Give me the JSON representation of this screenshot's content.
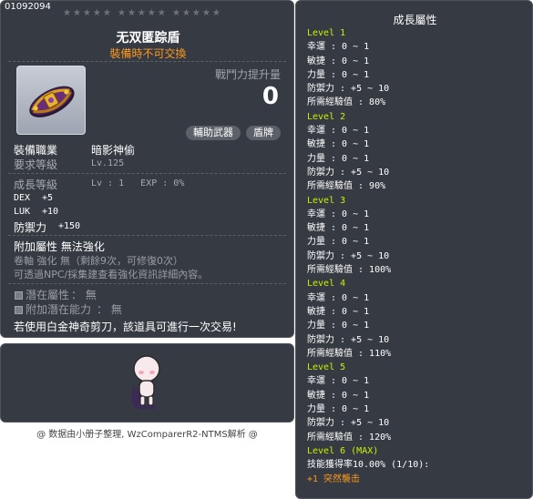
{
  "item": {
    "id": "01092094",
    "stars": "★★★★★ ★★★★★ ★★★★★",
    "name": "无双匿踪盾",
    "trade_note": "裝備時不可交換",
    "power_label": "戰鬥力提升量",
    "power_value": "0",
    "tags": [
      "輔助武器",
      "盾牌"
    ],
    "job_label": "裝備職業",
    "job_value": "暗影神偷",
    "req_label": "要求等級",
    "req_value": "Lv.125",
    "growth_label": "成長等級",
    "growth_value": "Lv : 1   EXP : 0%",
    "stats": [
      {
        "name": "DEX",
        "value": "+5"
      },
      {
        "name": "LUK",
        "value": "+10"
      },
      {
        "name": "防禦力",
        "value": "+150"
      }
    ],
    "enhance_line": "附加屬性 無法強化",
    "scroll_line": "卷軸 強化 無（剩餘9次，可修復0次）",
    "npc_line": "可透過NPC/採集建查看強化資訊詳細內容。",
    "potential_label": "潛在屬性",
    "potential_value": "： 無",
    "bonus_potential_label": "附加潛在能力",
    "bonus_potential_value": "： 無",
    "scissors_note": "若使用白金神奇剪刀，該道具可進行一次交易!"
  },
  "footer": {
    "credit": "@ 数据由小册子整理, WzComparerR2-NTMS解析 @"
  },
  "growth": {
    "title": "成長屬性",
    "lines": [
      {
        "text": "Level 1",
        "type": "level"
      },
      {
        "text": "幸運 : 0 ~ 1",
        "type": "stat"
      },
      {
        "text": "敏捷 : 0 ~ 1",
        "type": "stat"
      },
      {
        "text": "力量 : 0 ~ 1",
        "type": "stat"
      },
      {
        "text": "防禦力 : +5 ~ 10",
        "type": "stat"
      },
      {
        "text": "所需經驗值 : 80%",
        "type": "stat"
      },
      {
        "text": "Level 2",
        "type": "level"
      },
      {
        "text": "幸運 : 0 ~ 1",
        "type": "stat"
      },
      {
        "text": "敏捷 : 0 ~ 1",
        "type": "stat"
      },
      {
        "text": "力量 : 0 ~ 1",
        "type": "stat"
      },
      {
        "text": "防禦力 : +5 ~ 10",
        "type": "stat"
      },
      {
        "text": "所需經驗值 : 90%",
        "type": "stat"
      },
      {
        "text": "Level 3",
        "type": "level"
      },
      {
        "text": "幸運 : 0 ~ 1",
        "type": "stat"
      },
      {
        "text": "敏捷 : 0 ~ 1",
        "type": "stat"
      },
      {
        "text": "力量 : 0 ~ 1",
        "type": "stat"
      },
      {
        "text": "防禦力 : +5 ~ 10",
        "type": "stat"
      },
      {
        "text": "所需經驗值 : 100%",
        "type": "stat"
      },
      {
        "text": "Level 4",
        "type": "level"
      },
      {
        "text": "幸運 : 0 ~ 1",
        "type": "stat"
      },
      {
        "text": "敏捷 : 0 ~ 1",
        "type": "stat"
      },
      {
        "text": "力量 : 0 ~ 1",
        "type": "stat"
      },
      {
        "text": "防禦力 : +5 ~ 10",
        "type": "stat"
      },
      {
        "text": "所需經驗值 : 110%",
        "type": "stat"
      },
      {
        "text": "Level 5",
        "type": "level"
      },
      {
        "text": "幸運 : 0 ~ 1",
        "type": "stat"
      },
      {
        "text": "敏捷 : 0 ~ 1",
        "type": "stat"
      },
      {
        "text": "力量 : 0 ~ 1",
        "type": "stat"
      },
      {
        "text": "防禦力 : +5 ~ 10",
        "type": "stat"
      },
      {
        "text": "所需經驗值 : 120%",
        "type": "stat"
      },
      {
        "text": "Level 6 (MAX)",
        "type": "level"
      },
      {
        "text": "技能獲得率10.00% (1/10):",
        "type": "stat"
      },
      {
        "text": "+1 突然襲击",
        "type": "skill"
      }
    ]
  },
  "colors": {
    "panel_bg": "#363a42",
    "accent_orange": "#ff9a1f",
    "level_green": "#c8f000",
    "muted_text": "#a7aab0"
  },
  "icons": {
    "item_icon": "shield-item-icon",
    "avatar": "character-avatar",
    "potential_box": "potential-box-icon"
  }
}
